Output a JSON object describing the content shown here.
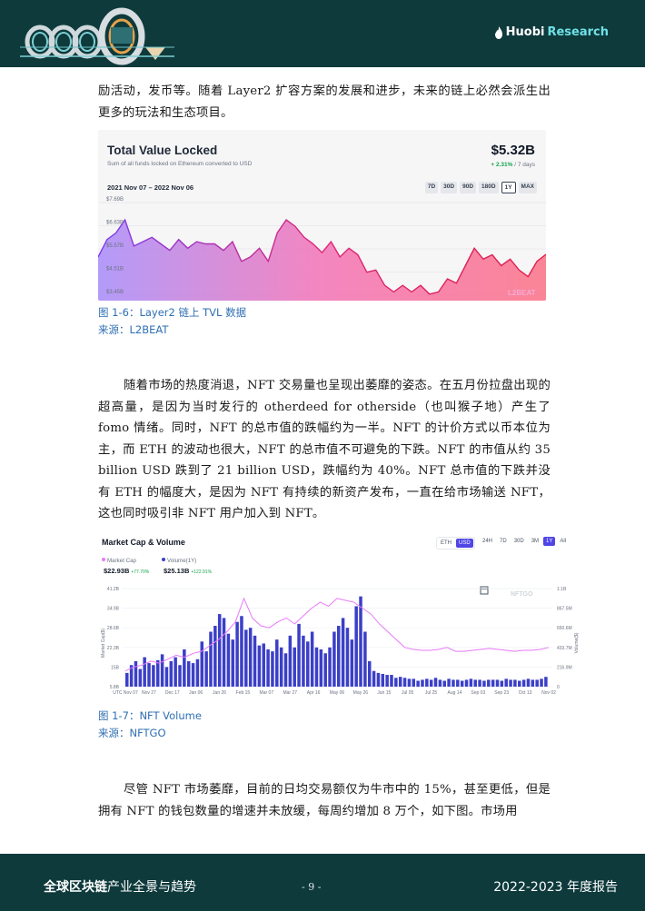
{
  "header": {
    "brand_name": "Huobi",
    "brand_suffix": "Research"
  },
  "paragraphs": {
    "p1": "励活动，发币等。随着 Layer2 扩容方案的发展和进步，未来的链上必然会派生出更多的玩法和生态项目。",
    "p2": "随着市场的热度消退，NFT 交易量也呈现出萎靡的姿态。在五月份拉盘出现的超高量，是因为当时发行的 otherdeed for otherside（也叫猴子地）产生了 fomo 情绪。同时，NFT 的总市值的跌幅约为一半。NFT 的计价方式以币本位为主，而 ETH 的波动也很大，NFT 的总市值不可避免的下跌。NFT 的市值从约 35 billion USD 跌到了 21 billion USD，跌幅约为 40%。NFT 总市值的下跌并没有 ETH 的幅度大，是因为 NFT 有持续的新资产发布，一直在给市场输送 NFT，这也同时吸引非 NFT 用户加入到 NFT。",
    "p3": "尽管 NFT 市场萎靡，目前的日均交易额仅为牛市中的 15%，甚至更低，但是拥有 NFT 的钱包数量的增速并未放缓，每周约增加 8 万个，如下图。市场用"
  },
  "figure1": {
    "caption": "图 1-6：Layer2 链上 TVL 数据",
    "source": "来源：L2BEAT",
    "title": "Total Value Locked",
    "subtitle": "Sum of all funds locked on Ethereum converted to USD",
    "value": "$5.32B",
    "change": "+ 2.31%",
    "change_period": " / 7 days",
    "date_range": "2021 Nov 07 – 2022 Nov 06",
    "range_buttons": [
      "7D",
      "30D",
      "90D",
      "180D",
      "1Y",
      "MAX"
    ],
    "active_range": "1Y",
    "watermark": "L2BEAT"
  },
  "figure2": {
    "caption": "图 1-7：NFT Volume",
    "source": "来源：NFTGO",
    "title": "Market Cap & Volume",
    "currency_buttons": [
      "ETH",
      "USD"
    ],
    "active_currency": "USD",
    "range_buttons": [
      "24H",
      "7D",
      "30D",
      "3M",
      "1Y",
      "All"
    ],
    "active_range": "1Y",
    "legend_mc_label": "Market Cap",
    "legend_mc_value": "$22.93B",
    "legend_mc_change": "+77.70%",
    "legend_vol_label": "Volume(1Y)",
    "legend_vol_value": "$25.13B",
    "legend_vol_change": "+122.91%",
    "watermark": "NFTGO"
  },
  "chart_data": [
    {
      "type": "area",
      "title": "Total Value Locked",
      "ylabel": "",
      "x_range": [
        "2021 Nov 07",
        "2022 Nov 06"
      ],
      "y_tick_labels": [
        "$3.45B",
        "$4.51B",
        "$5.57B",
        "$6.63B",
        "$7.69B"
      ],
      "ylim": [
        3.45,
        7.69
      ],
      "x": [
        0,
        2,
        4,
        6,
        8,
        10,
        12,
        14,
        16,
        18,
        20,
        22,
        24,
        26,
        28,
        30,
        32,
        34,
        36,
        38,
        40,
        42,
        44,
        46,
        48,
        50,
        52,
        54,
        56,
        58,
        60,
        62,
        64,
        66,
        68,
        70,
        72,
        74,
        76,
        78,
        80,
        82,
        84,
        86,
        88,
        90,
        92,
        94,
        96,
        98,
        100
      ],
      "values": [
        5.2,
        6.0,
        6.3,
        6.9,
        5.7,
        5.9,
        6.1,
        5.8,
        5.5,
        6.0,
        5.6,
        5.9,
        5.8,
        5.8,
        5.5,
        5.9,
        5.0,
        5.2,
        5.6,
        5.0,
        6.3,
        6.9,
        6.6,
        6.1,
        5.8,
        5.4,
        5.9,
        5.2,
        5.6,
        5.3,
        4.5,
        4.6,
        3.9,
        3.6,
        3.9,
        3.6,
        3.9,
        3.5,
        3.6,
        4.2,
        4.0,
        4.8,
        5.6,
        5.1,
        5.3,
        4.8,
        5.1,
        4.6,
        4.3,
        5.0,
        5.32
      ],
      "color_gradient": [
        "#a78bfa",
        "#f472b6",
        "#fb7185"
      ]
    },
    {
      "type": "bar",
      "title": "Market Cap & Volume",
      "ylabel": "Market Cap($)",
      "y2label": "Volume($)",
      "x_tick_labels": [
        "UTC Nov 07",
        "Nov 27",
        "Dec 17",
        "Jan 06",
        "Jan 26",
        "Feb 15",
        "Mar 07",
        "Mar 27",
        "Apr 16",
        "May 06",
        "May 26",
        "Jun 15",
        "Jul 05",
        "Jul 25",
        "Aug 14",
        "Sep 03",
        "Sep 23",
        "Oct 13",
        "Nov 02"
      ],
      "y_tick_labels": [
        "5.8B",
        "15B",
        "22.3B",
        "28.6B",
        "34.9B",
        "41.2B"
      ],
      "y2_tick_labels": [
        "0",
        "216.9M",
        "433.7M",
        "650.6M",
        "867.5M",
        "1.1B"
      ],
      "series": [
        {
          "name": "Volume(1Y)",
          "kind": "bar",
          "color": "#3b3fc7",
          "values": [
            0.14,
            0.22,
            0.26,
            0.18,
            0.3,
            0.24,
            0.22,
            0.27,
            0.33,
            0.2,
            0.26,
            0.3,
            0.22,
            0.38,
            0.26,
            0.24,
            0.28,
            0.46,
            0.36,
            0.56,
            0.62,
            0.74,
            0.7,
            0.54,
            0.48,
            0.66,
            0.72,
            0.58,
            0.6,
            0.52,
            0.42,
            0.44,
            0.38,
            0.36,
            0.48,
            0.4,
            0.34,
            0.52,
            0.4,
            0.64,
            0.52,
            0.46,
            0.56,
            0.4,
            0.38,
            0.34,
            0.4,
            0.56,
            0.62,
            0.7,
            0.6,
            0.48,
            0.82,
            0.92,
            0.56,
            0.26,
            0.16,
            0.14,
            0.13,
            0.12,
            0.12,
            0.09,
            0.1,
            0.09,
            0.08,
            0.08,
            0.06,
            0.07,
            0.08,
            0.07,
            0.09,
            0.07,
            0.06,
            0.08,
            0.07,
            0.07,
            0.06,
            0.07,
            0.08,
            0.07,
            0.07,
            0.06,
            0.07,
            0.07,
            0.07,
            0.06,
            0.08,
            0.07,
            0.07,
            0.06,
            0.07,
            0.08,
            0.07,
            0.07,
            0.08,
            0.1
          ]
        },
        {
          "name": "Market Cap",
          "kind": "line",
          "color": "#e879f9",
          "values": [
            0.16,
            0.2,
            0.22,
            0.26,
            0.24,
            0.28,
            0.32,
            0.3,
            0.34,
            0.36,
            0.42,
            0.48,
            0.56,
            0.66,
            0.9,
            0.7,
            0.62,
            0.6,
            0.66,
            0.7,
            0.64,
            0.72,
            0.8,
            0.86,
            0.82,
            0.9,
            0.88,
            0.86,
            0.8,
            0.74,
            0.64,
            0.56,
            0.48,
            0.4,
            0.38,
            0.37,
            0.37,
            0.38,
            0.4,
            0.36,
            0.36,
            0.37,
            0.38,
            0.39,
            0.38,
            0.37,
            0.36,
            0.37,
            0.37,
            0.38,
            0.4
          ]
        }
      ]
    }
  ],
  "footer": {
    "left_bold": "全球区块链",
    "left_rest": "产业全景与趋势",
    "page": "- 9 -",
    "right_num": "2022-2023",
    "right_text": " 年度报告"
  }
}
